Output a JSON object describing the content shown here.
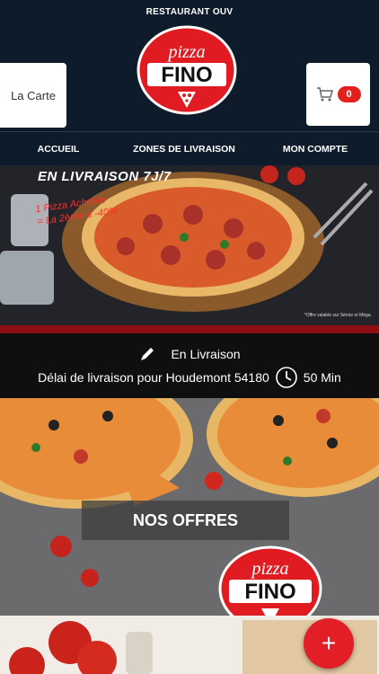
{
  "status_bar": {
    "text": "RESTAURANT OUV"
  },
  "brand": {
    "line1": "pizza",
    "line2": "FINO"
  },
  "header": {
    "menu_label": "La Carte",
    "cart_icon": "cart-icon",
    "cart_count": "0"
  },
  "nav": {
    "items": [
      "ACCUEIL",
      "ZONES DE LIVRAISON",
      "MON COMPTE"
    ]
  },
  "hero": {
    "title": "EN LIVRAISON 7J/7",
    "promo_line1": "1 Pizza Achetée",
    "promo_line2": "= La 2ème à -40%",
    "note": "*Offre valable sur Sénior et Méga."
  },
  "delivery": {
    "title": "En Livraison",
    "text": "Délai de livraison pour Houdemont 54180",
    "time": "50 Min",
    "icons": [
      "edit-icon",
      "clock-icon"
    ]
  },
  "offers": {
    "label": "NOS OFFRES"
  },
  "fab": {
    "label": "+"
  },
  "colors": {
    "header_bg": "#0d1b2a",
    "accent_red": "#e2211c",
    "delivery_bg": "#0f0f10",
    "divider": "#8e0f12"
  }
}
